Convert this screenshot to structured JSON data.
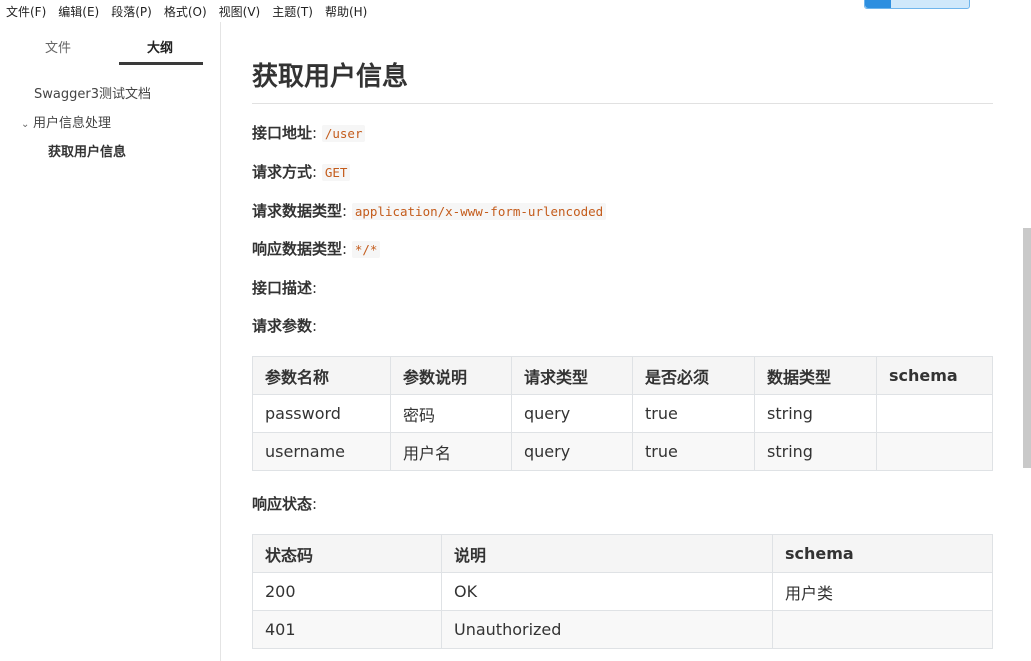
{
  "menu": [
    "文件(F)",
    "编辑(E)",
    "段落(P)",
    "格式(O)",
    "视图(V)",
    "主题(T)",
    "帮助(H)"
  ],
  "sidebar": {
    "tabs": [
      "文件",
      "大纲"
    ],
    "outline": [
      "Swagger3测试文档",
      "用户信息处理",
      "获取用户信息"
    ]
  },
  "doc": {
    "title": "获取用户信息",
    "fields": [
      {
        "key": "接口地址",
        "value": "/user"
      },
      {
        "key": "请求方式",
        "value": "GET"
      },
      {
        "key": "请求数据类型",
        "value": "application/x-www-form-urlencoded"
      },
      {
        "key": "响应数据类型",
        "value": "*/*"
      },
      {
        "key": "接口描述",
        "value": ""
      },
      {
        "key": "请求参数",
        "value": ""
      }
    ],
    "params_table": {
      "headers": [
        "参数名称",
        "参数说明",
        "请求类型",
        "是否必须",
        "数据类型",
        "schema"
      ],
      "rows": [
        [
          "password",
          "密码",
          "query",
          "true",
          "string",
          ""
        ],
        [
          "username",
          "用户名",
          "query",
          "true",
          "string",
          ""
        ]
      ]
    },
    "response_label": "响应状态",
    "response_table": {
      "headers": [
        "状态码",
        "说明",
        "schema"
      ],
      "rows": [
        [
          "200",
          "OK",
          "用户类"
        ],
        [
          "401",
          "Unauthorized",
          ""
        ]
      ]
    }
  }
}
